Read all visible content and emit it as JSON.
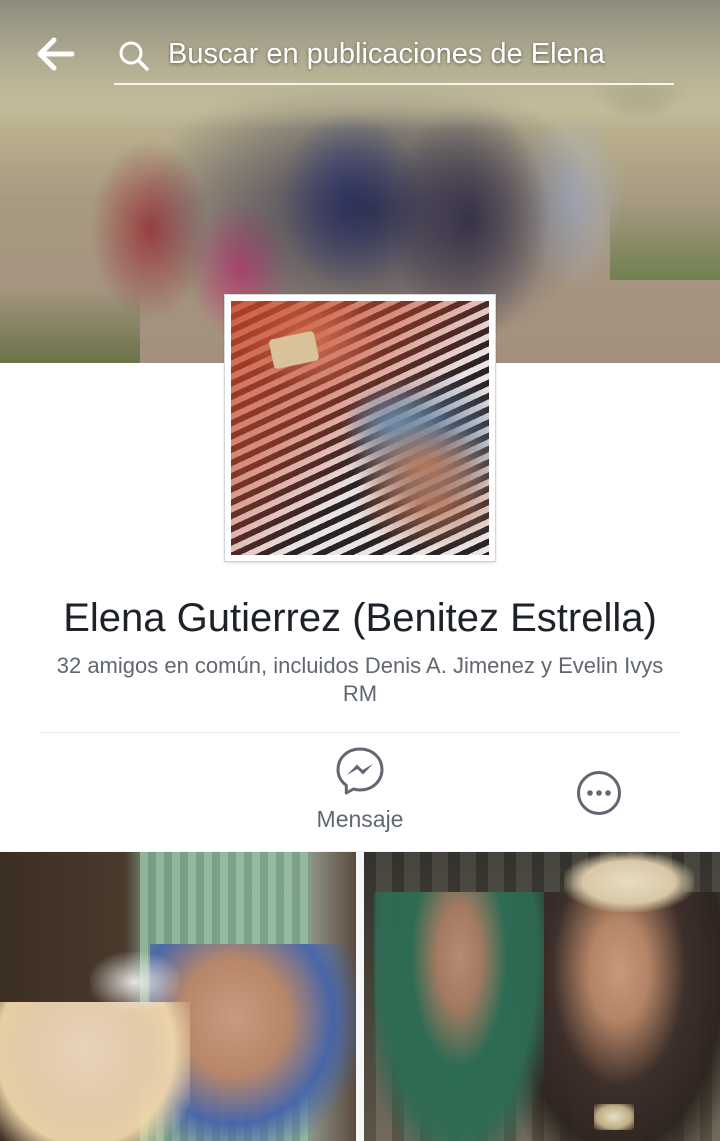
{
  "header": {
    "back_label": "Back",
    "search_placeholder": "Buscar en publicaciones de Elena"
  },
  "profile": {
    "name": "Elena Gutierrez (Benitez Estrella)",
    "mutual_friends": "32 amigos en común, incluidos Denis A. Jimenez y Evelin Ivys RM"
  },
  "actions": {
    "message_label": "Mensaje",
    "more_icon": "more-dots-icon",
    "message_icon": "messenger-icon"
  },
  "colors": {
    "accent_gray": "#616770",
    "text_dark": "#1d2129",
    "divider": "#e5e6e9"
  }
}
